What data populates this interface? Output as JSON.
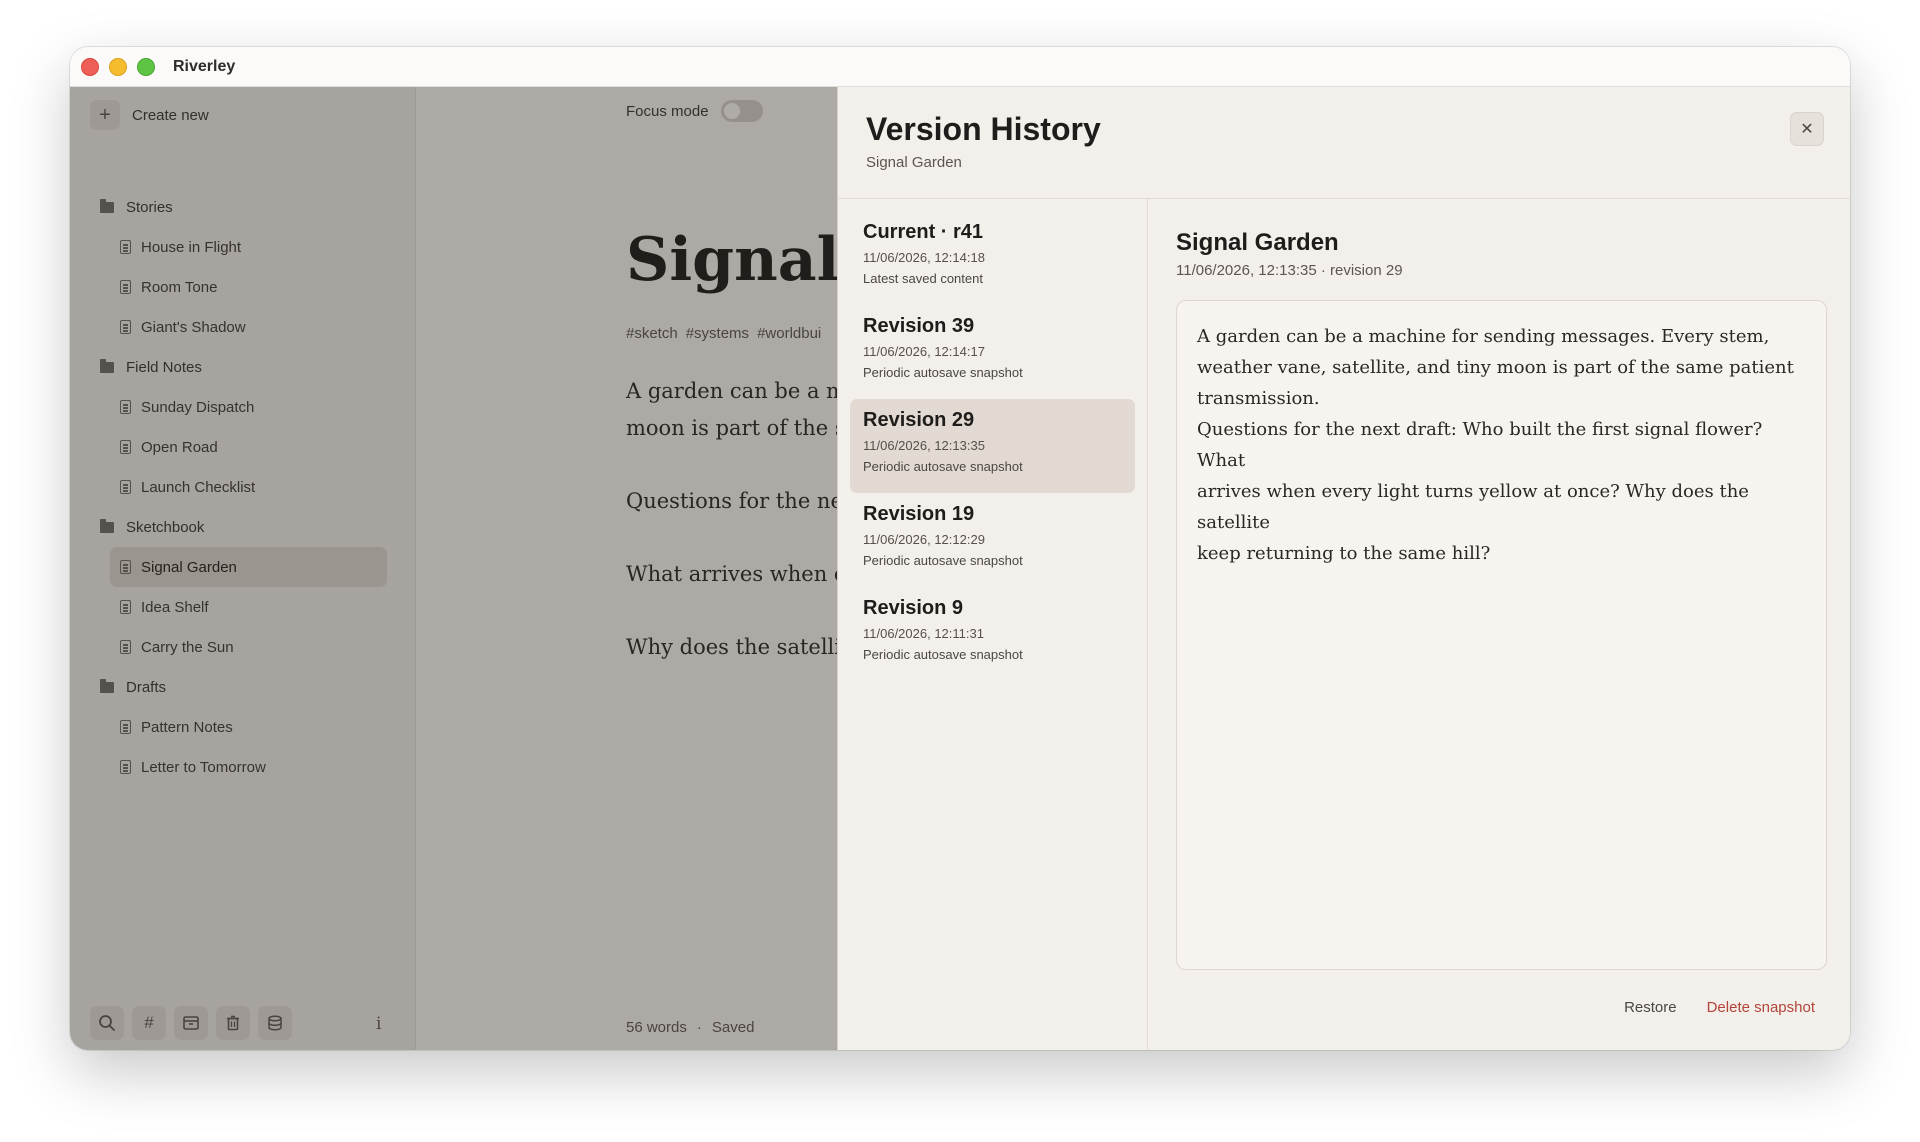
{
  "app": {
    "title": "Riverley"
  },
  "sidebar": {
    "create_new": "Create new",
    "folders": [
      {
        "name": "Stories",
        "notes": [
          "House in Flight",
          "Room Tone",
          "Giant's Shadow"
        ]
      },
      {
        "name": "Field Notes",
        "notes": [
          "Sunday Dispatch",
          "Open Road",
          "Launch Checklist"
        ]
      },
      {
        "name": "Sketchbook",
        "notes": [
          "Signal Garden",
          "Idea Shelf",
          "Carry the Sun"
        ]
      },
      {
        "name": "Drafts",
        "notes": [
          "Pattern Notes",
          "Letter to Tomorrow"
        ]
      }
    ],
    "selected_note": "Signal Garden",
    "tools": [
      "search-icon",
      "hashtag-icon",
      "archive-icon",
      "trash-icon",
      "database-icon"
    ],
    "info": "i"
  },
  "editor": {
    "focus_label": "Focus mode",
    "focus_on": false,
    "title": "Signal G",
    "tags": [
      "#sketch",
      "#systems",
      "#worldbui"
    ],
    "paragraphs": [
      "A garden can be a ma",
      "moon is part of the sa",
      "Questions for the nex",
      "What arrives when ev",
      "Why does the satellit"
    ],
    "word_count": "56 words",
    "separator": "·",
    "save_status": "Saved"
  },
  "version_history": {
    "title": "Version History",
    "subtitle": "Signal Garden",
    "close_icon": "close-icon",
    "revisions": [
      {
        "name": "Current · r41",
        "time": "11/06/2026, 12:14:18",
        "desc": "Latest saved content"
      },
      {
        "name": "Revision 39",
        "time": "11/06/2026, 12:14:17",
        "desc": "Periodic autosave snapshot"
      },
      {
        "name": "Revision 29",
        "time": "11/06/2026, 12:13:35",
        "desc": "Periodic autosave snapshot"
      },
      {
        "name": "Revision 19",
        "time": "11/06/2026, 12:12:29",
        "desc": "Periodic autosave snapshot"
      },
      {
        "name": "Revision 9",
        "time": "11/06/2026, 12:11:31",
        "desc": "Periodic autosave snapshot"
      }
    ],
    "selected_revision": "Revision 29",
    "preview": {
      "title": "Signal Garden",
      "meta": "11/06/2026, 12:13:35 · revision 29",
      "lines": [
        "A garden can be a machine for sending messages. Every stem,",
        "weather vane, satellite, and tiny moon is part of the same patient",
        "transmission.",
        "Questions for the next draft: Who built the first signal flower? What",
        "arrives when every light turns yellow at once? Why does the satellite",
        "keep returning to the same hill?"
      ]
    },
    "restore": "Restore",
    "delete": "Delete snapshot"
  },
  "colors": {
    "delete_accent": "#b2453a",
    "selected_bg": "#e2dad2",
    "overlay": "rgba(38,34,31,0.34)"
  }
}
